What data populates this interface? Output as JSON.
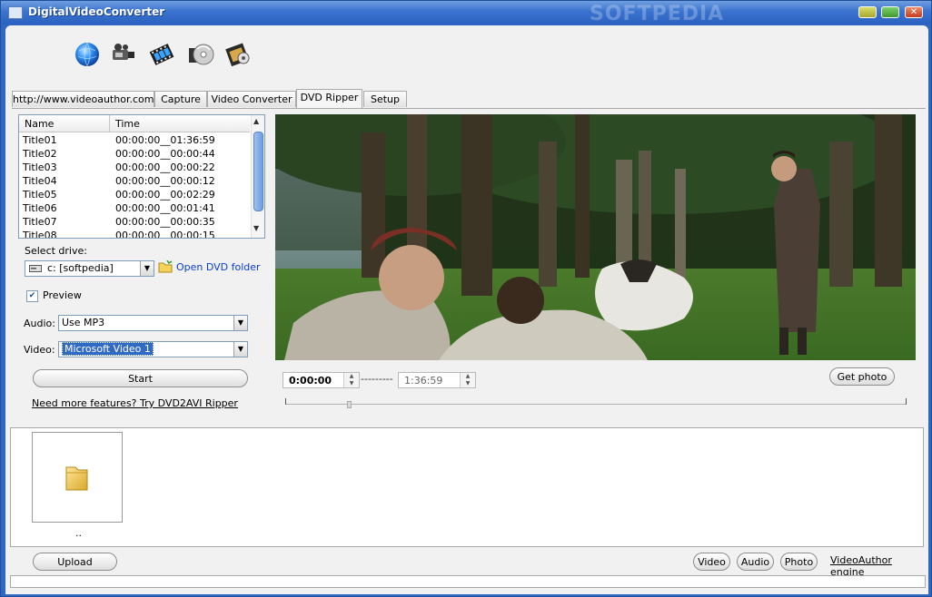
{
  "window": {
    "title": "DigitalVideoConverter",
    "watermark": "SOFTPEDIA",
    "close_glyph": "✕"
  },
  "toolbar": {
    "icons": [
      "globe-icon",
      "camcorder-icon",
      "film-strip-icon",
      "dvd-disc-icon",
      "film-settings-icon"
    ]
  },
  "tabs": [
    {
      "label": "http://www.videoauthor.com",
      "active": false
    },
    {
      "label": "Capture",
      "active": false
    },
    {
      "label": "Video Converter",
      "active": false
    },
    {
      "label": "DVD Ripper",
      "active": true
    },
    {
      "label": "Setup",
      "active": false
    }
  ],
  "titles": {
    "columns": [
      "Name",
      "Time"
    ],
    "rows": [
      {
        "name": "Title01",
        "time": "00:00:00__01:36:59"
      },
      {
        "name": "Title02",
        "time": "00:00:00__00:00:44"
      },
      {
        "name": "Title03",
        "time": "00:00:00__00:00:22"
      },
      {
        "name": "Title04",
        "time": "00:00:00__00:00:12"
      },
      {
        "name": "Title05",
        "time": "00:00:00__00:02:29"
      },
      {
        "name": "Title06",
        "time": "00:00:00__00:01:41"
      },
      {
        "name": "Title07",
        "time": "00:00:00__00:00:35"
      },
      {
        "name": "Title08",
        "time": "00:00:00__00:00:15"
      }
    ]
  },
  "drive": {
    "label": "Select drive:",
    "value": "c: [softpedia]",
    "open_folder": "Open DVD folder"
  },
  "preview": {
    "label": "Preview",
    "checked": true,
    "check_glyph": "✔"
  },
  "audio": {
    "label": "Audio:",
    "value": "Use MP3"
  },
  "video": {
    "label": "Video:",
    "value": "Microsoft Video 1"
  },
  "start_button": "Start",
  "more_features_link": "Need more features? Try DVD2AVI Ripper",
  "player": {
    "start_time": "0:00:00",
    "separator": "---------",
    "end_time": "1:36:59",
    "get_photo": "Get photo",
    "position_fraction": 0.1
  },
  "browser": {
    "items": [
      {
        "label": "..",
        "icon": "folder-icon"
      }
    ]
  },
  "footer": {
    "upload": "Upload",
    "video": "Video",
    "audio": "Audio",
    "photo": "Photo",
    "engine_link": "VideoAuthor engine"
  },
  "glyphs": {
    "dropdown": "▼",
    "scroll_up": "▲",
    "scroll_down": "▼",
    "spin_up": "▲",
    "spin_down": "▼"
  }
}
